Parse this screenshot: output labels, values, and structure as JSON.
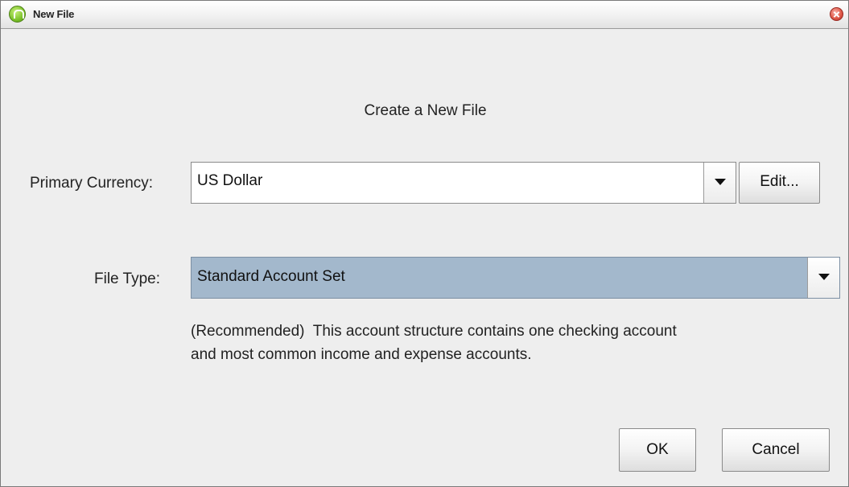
{
  "window": {
    "title": "New File"
  },
  "dialog": {
    "heading": "Create a New File",
    "currency": {
      "label": "Primary Currency:",
      "value": "US Dollar",
      "edit_label": "Edit..."
    },
    "file_type": {
      "label": "File Type:",
      "value": "Standard Account Set",
      "description_line1": "(Recommended)  This account structure contains one checking account",
      "description_line2": "and most common income and expense accounts."
    },
    "buttons": {
      "ok_label": "OK",
      "cancel_label": "Cancel"
    }
  },
  "icons": {
    "app": "moneydance-app-icon",
    "close": "close-icon",
    "dropdown": "chevron-down-icon"
  },
  "colors": {
    "window_bg": "#eeeeee",
    "selected_combo_bg": "#a3b8cc",
    "close_red": "#e05a4a",
    "app_green": "#7cc22a"
  }
}
